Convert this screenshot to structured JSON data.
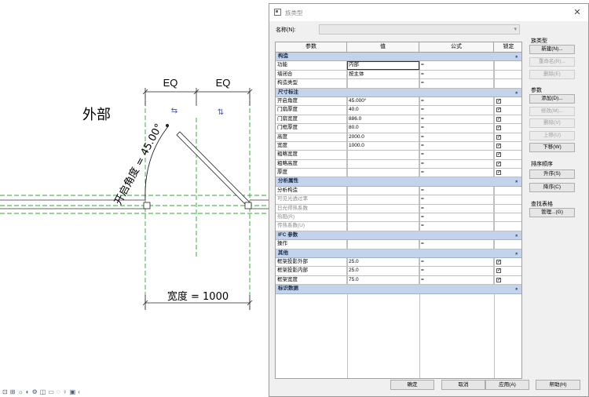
{
  "drawing": {
    "eq_left": "EQ",
    "eq_right": "EQ",
    "exterior_label": "外部",
    "angle_label": "开启角度 = 45.00°",
    "width_label": "宽度 = 1000",
    "flip_h_symbol": "⇆",
    "flip_v_symbol": "⇅",
    "line_color": "#2ea82e",
    "accent_blue": "#3a56c8"
  },
  "bottom_toolbar": {
    "icons": [
      "view-cube-icon",
      "display-style-icon",
      "sun-path-icon",
      "shadows-icon",
      "render-icon",
      "crop-icon",
      "show-crop-icon",
      "temp-hide-icon",
      "reveal-hidden-icon",
      "analytic-model-icon",
      "scroll-left-icon"
    ],
    "glyphs": [
      "⊡",
      "⊞",
      "☼",
      "◐",
      "⚙",
      "◫",
      "▭",
      "◌",
      "♀",
      "▣",
      "‹"
    ]
  },
  "dialog": {
    "title": "族类型",
    "close_glyph": "✕",
    "name_label": "名称(N):",
    "columns": [
      "参数",
      "值",
      "公式",
      "锁定"
    ],
    "groups": [
      {
        "name": "构造",
        "chevron": "»",
        "rows": [
          {
            "param": "功能",
            "value": "内部",
            "formula": "=",
            "lock": false,
            "show_lock": false,
            "editing": true
          },
          {
            "param": "墙闭合",
            "value": "按主体",
            "formula": "=",
            "lock": false,
            "show_lock": false
          },
          {
            "param": "构造类型",
            "value": "",
            "formula": "=",
            "lock": false,
            "show_lock": false
          }
        ]
      },
      {
        "name": "尺寸标注",
        "chevron": "»",
        "rows": [
          {
            "param": "开启角度",
            "value": "45.000°",
            "formula": "=",
            "lock": true,
            "show_lock": true
          },
          {
            "param": "门扇厚度",
            "value": "40.0",
            "formula": "=",
            "lock": true,
            "show_lock": true
          },
          {
            "param": "门扇宽度",
            "value": "886.0",
            "formula": "=",
            "lock": true,
            "show_lock": true
          },
          {
            "param": "门框厚度",
            "value": "80.0",
            "formula": "=",
            "lock": true,
            "show_lock": true
          },
          {
            "param": "高度",
            "value": "2000.0",
            "formula": "=",
            "lock": true,
            "show_lock": true
          },
          {
            "param": "宽度",
            "value": "1000.0",
            "formula": "=",
            "lock": true,
            "show_lock": true
          },
          {
            "param": "粗略宽度",
            "value": "",
            "formula": "=",
            "lock": true,
            "show_lock": true
          },
          {
            "param": "粗略高度",
            "value": "",
            "formula": "=",
            "lock": true,
            "show_lock": true
          },
          {
            "param": "厚度",
            "value": "",
            "formula": "=",
            "lock": true,
            "show_lock": true
          }
        ]
      },
      {
        "name": "分析属性",
        "chevron": "»",
        "rows": [
          {
            "param": "分析构造",
            "value": "",
            "formula": "=",
            "lock": false,
            "show_lock": false
          },
          {
            "param": "可见光透过率",
            "value": "",
            "formula": "=",
            "lock": false,
            "show_lock": false,
            "disabled": true
          },
          {
            "param": "日光得热系数",
            "value": "",
            "formula": "=",
            "lock": false,
            "show_lock": false,
            "disabled": true
          },
          {
            "param": "热阻(R)",
            "value": "",
            "formula": "=",
            "lock": false,
            "show_lock": false,
            "disabled": true
          },
          {
            "param": "传热系数(U)",
            "value": "",
            "formula": "=",
            "lock": false,
            "show_lock": false,
            "disabled": true
          }
        ]
      },
      {
        "name": "IFC 参数",
        "chevron": "»",
        "rows": [
          {
            "param": "操作",
            "value": "",
            "formula": "=",
            "lock": false,
            "show_lock": false
          }
        ]
      },
      {
        "name": "其他",
        "chevron": "»",
        "rows": [
          {
            "param": "框架投影外部",
            "value": "25.0",
            "formula": "=",
            "lock": true,
            "show_lock": true
          },
          {
            "param": "框架投影内部",
            "value": "25.0",
            "formula": "=",
            "lock": true,
            "show_lock": true
          },
          {
            "param": "框架宽度",
            "value": "75.0",
            "formula": "=",
            "lock": true,
            "show_lock": true
          }
        ]
      },
      {
        "name": "标识数据",
        "chevron": "»",
        "rows": []
      }
    ],
    "family_types": {
      "label": "族类型",
      "new": "新建(N)...",
      "rename": "重命名(R)...",
      "delete": "删除(E)"
    },
    "parameters": {
      "label": "参数",
      "add": "添加(D)...",
      "modify": "修改(M)...",
      "remove": "删除(V)",
      "move_up": "上移(U)",
      "move_down": "下移(W)"
    },
    "sort_order": {
      "label": "排序顺序",
      "ascending": "升序(S)",
      "descending": "降序(C)"
    },
    "lookup_tables": {
      "label": "查找表格",
      "manage": "管理...(G)"
    },
    "buttons": {
      "ok": "确定",
      "cancel": "取消",
      "apply": "应用(A)",
      "help": "帮助(H)"
    }
  }
}
